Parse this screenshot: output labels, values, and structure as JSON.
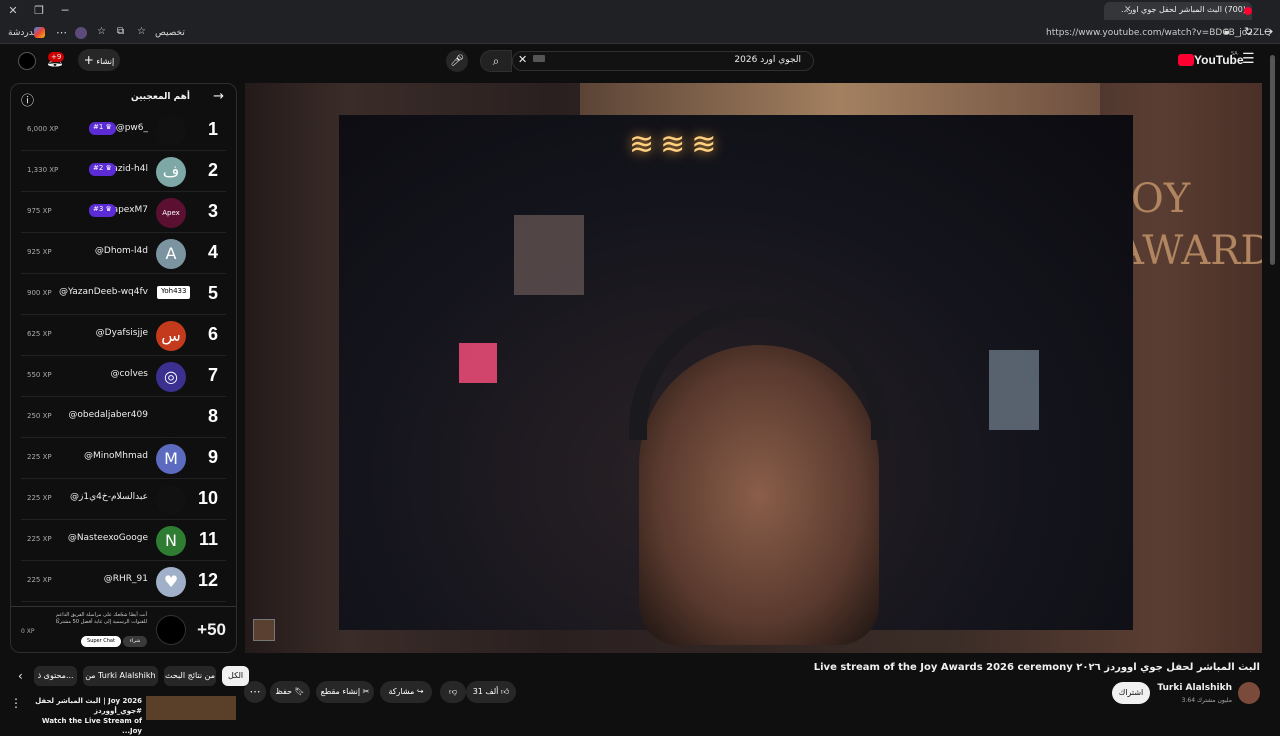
{
  "browser": {
    "tab_title": "(700) البث المباشر لحفل جوي اور...",
    "url": "https://www.youtube.com/watch?v=BDCB_jo2ZLQ",
    "extension_label": "تخصيص",
    "bookmark_label": "الدردشة"
  },
  "header": {
    "search_value": "الجوي اورد 2026",
    "create_label": "إنشاء",
    "notif_count": "+9",
    "logo_text": "YouTube",
    "logo_sup": "SA"
  },
  "leaderboard": {
    "title": "أهم المعجبين",
    "rows": [
      {
        "rank": "1",
        "name": "@pw6_",
        "xp": "6,000 XP",
        "badge": "#1 ♛",
        "avatar": "",
        "avatar_color": "#111111"
      },
      {
        "rank": "2",
        "name": "@yazid-h4l",
        "xp": "1,330 XP",
        "badge": "#2 ♛",
        "avatar": "ف",
        "avatar_color": "#7ea8a5"
      },
      {
        "rank": "3",
        "name": "@apexM7",
        "xp": "975 XP",
        "badge": "#3 ♛",
        "avatar": "Apex",
        "avatar_color": "#5b1032"
      },
      {
        "rank": "4",
        "name": "@Dhom-l4d",
        "xp": "925 XP",
        "badge": "",
        "avatar": "A",
        "avatar_color": "#7c94a0"
      },
      {
        "rank": "5",
        "name": "@YazanDeeb-wq4fv",
        "xp": "900 XP",
        "badge": "Yoh433",
        "avatar": "",
        "avatar_color": "#0f0f0f"
      },
      {
        "rank": "6",
        "name": "@Dyafsisjje",
        "xp": "625 XP",
        "badge": "",
        "avatar": "س",
        "avatar_color": "#c43a1c"
      },
      {
        "rank": "7",
        "name": "@colves",
        "xp": "550 XP",
        "badge": "",
        "avatar": "◎",
        "avatar_color": "#3b2f8f"
      },
      {
        "rank": "8",
        "name": "@obedaljaber409",
        "xp": "250 XP",
        "badge": "",
        "avatar": "",
        "avatar_color": "#0f0f0f"
      },
      {
        "rank": "9",
        "name": "@MinoMhmad",
        "xp": "225 XP",
        "badge": "",
        "avatar": "M",
        "avatar_color": "#5c6bc0"
      },
      {
        "rank": "10",
        "name": "@عبدالسلام-خ4ي1ز",
        "xp": "225 XP",
        "badge": "",
        "avatar": "",
        "avatar_color": "#111111"
      },
      {
        "rank": "11",
        "name": "@NasteexoGooge",
        "xp": "225 XP",
        "badge": "",
        "avatar": "N",
        "avatar_color": "#2e7d32"
      },
      {
        "rank": "12",
        "name": "@RHR_91",
        "xp": "225 XP",
        "badge": "",
        "avatar": "♥",
        "avatar_color": "#9fb0c8"
      }
    ],
    "footer_rank": "+50",
    "footer_xp": "0 XP",
    "footer_text": "أنت أيضًا شجّعك على مراسلة الفريق الداعم للقنوات الرسمية إلى غاية أفضل 50 مشتركًا",
    "footer_btn1": "Super Chat",
    "footer_btn2": "شراء"
  },
  "video": {
    "title": "البث المباشر لحفل جوي اووردز ٢٠٢٦ Live stream of the Joy Awards 2026 ceremony",
    "watermark": "JOY\nAWARDS"
  },
  "channel": {
    "name": "Turki Alalshikh",
    "subs": "3.64 مليون مشترك",
    "subscribe_label": "اشتراك"
  },
  "actions": {
    "like_count": "31 ألف",
    "share_label": "مشاركة",
    "clip_label": "إنشاء مقطع",
    "save_label": "حفظ"
  },
  "chips": [
    {
      "label": "الكل"
    },
    {
      "label": "من نتائج البحث"
    },
    {
      "label": "من Turki Alalshikh"
    },
    {
      "label": "محتوى ذ..."
    }
  ],
  "next_video": {
    "title": "Joy 2026 | البث المباشر لحفل #جوي_أووردز",
    "subtitle": "Watch the Live Stream of Joy..."
  }
}
